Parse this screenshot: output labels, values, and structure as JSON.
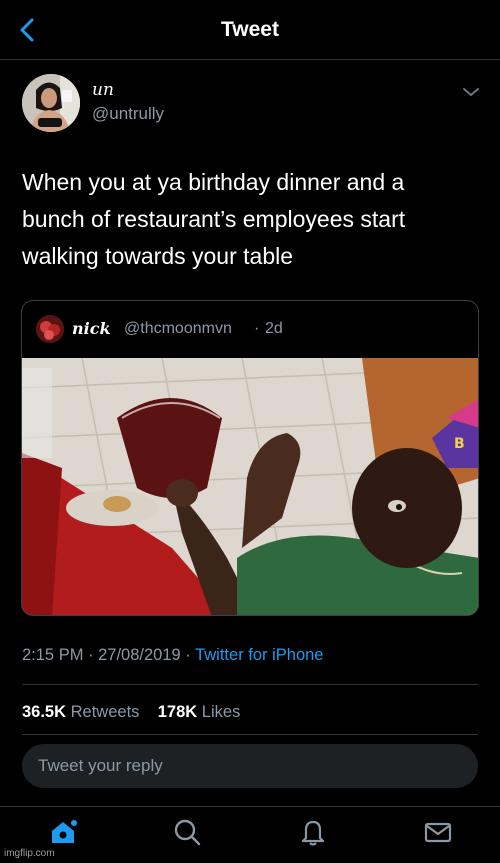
{
  "header": {
    "title": "Tweet"
  },
  "tweet": {
    "display_name": "un",
    "handle": "@untrully",
    "text_lines": [
      "When you at ya birthday dinner and a",
      "bunch of restaurant’s employees start",
      "walking towards your table"
    ],
    "quoted": {
      "display_name": "nick",
      "handle": "@thcmoonmvn",
      "separator": "·",
      "time": "2d"
    },
    "meta": {
      "time": "2:15 PM",
      "sep1": " · ",
      "date": "27/08/2019",
      "sep2": " · ",
      "source": "Twitter for iPhone"
    },
    "stats": {
      "retweets_count": "36.5K",
      "retweets_label": "Retweets",
      "likes_count": "178K",
      "likes_label": "Likes"
    }
  },
  "reply": {
    "placeholder": "Tweet your reply"
  },
  "nav": {
    "items": [
      {
        "icon": "home-icon"
      },
      {
        "icon": "search-icon"
      },
      {
        "icon": "bell-icon"
      },
      {
        "icon": "mail-icon"
      }
    ],
    "accent": "#1d9bf0",
    "inactive": "#8b98a5"
  },
  "watermark": "imgflip.com"
}
